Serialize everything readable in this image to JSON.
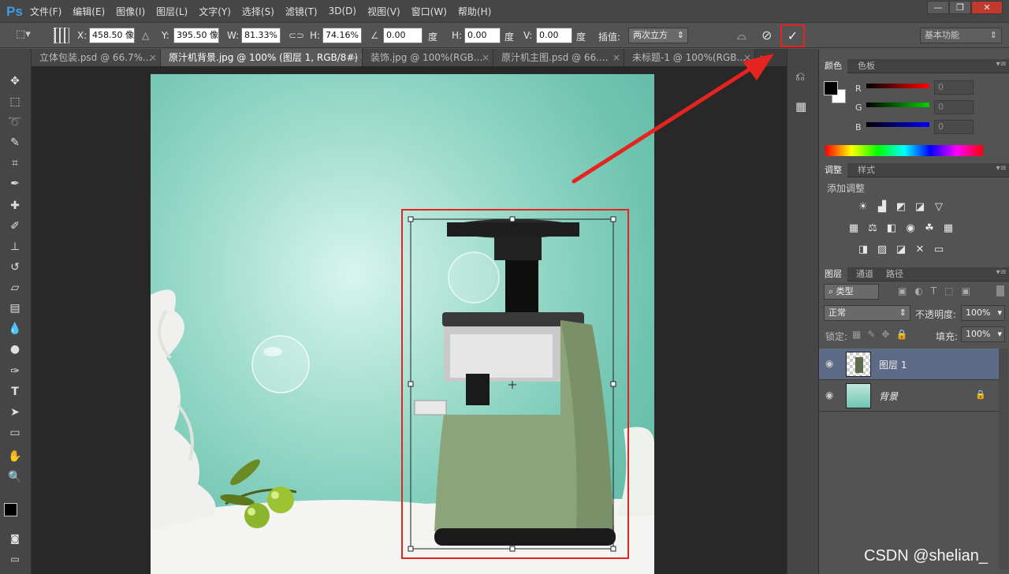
{
  "app": {
    "logo": "Ps"
  },
  "menu": [
    "文件(F)",
    "编辑(E)",
    "图像(I)",
    "图层(L)",
    "文字(Y)",
    "选择(S)",
    "滤镜(T)",
    "3D(D)",
    "视图(V)",
    "窗口(W)",
    "帮助(H)"
  ],
  "window_buttons": {
    "minimize": "—",
    "restore": "❐",
    "close": "✕"
  },
  "options": {
    "x_label": "X:",
    "x_value": "458.50 像",
    "y_label": "Y:",
    "y_value": "395.50 像",
    "w_label": "W:",
    "w_value": "81.33%",
    "h_label": "H:",
    "h_value": "74.16%",
    "angle_value": "0.00",
    "angle_unit": "度",
    "hskew_label": "H:",
    "hskew_value": "0.00",
    "hskew_unit": "度",
    "vskew_label": "V:",
    "vskew_value": "0.00",
    "vskew_unit": "度",
    "interp_label": "插值:",
    "interp_value": "两次立方",
    "workspace": "基本功能"
  },
  "tabs": [
    {
      "label": "立体包装.psd @ 66.7%..."
    },
    {
      "label": "原汁机背景.jpg @ 100% (图层 1, RGB/8#) *"
    },
    {
      "label": "装饰.jpg @ 100%(RGB..."
    },
    {
      "label": "原汁机主图.psd @ 66...."
    },
    {
      "label": "未标题-1 @ 100%(RGB..."
    }
  ],
  "color_panel": {
    "tabs": [
      "颜色",
      "色板"
    ],
    "r": "R",
    "g": "G",
    "b": "B",
    "r_val": "0",
    "g_val": "0",
    "b_val": "0"
  },
  "adjust_panel": {
    "tabs": [
      "调整",
      "样式"
    ],
    "title": "添加调整"
  },
  "layers_panel": {
    "tabs": [
      "图层",
      "通道",
      "路径"
    ],
    "filter": "类型",
    "blend": "正常",
    "opacity_label": "不透明度:",
    "opacity": "100%",
    "lock_label": "锁定:",
    "fill_label": "填充:",
    "fill": "100%",
    "layers": [
      {
        "name": "图层 1"
      },
      {
        "name": "背景"
      }
    ]
  },
  "watermark": "CSDN @shelian_",
  "colors": {
    "annotation_red": "#e52420",
    "accent_blue": "#3d9ee8",
    "panel_bg": "#535353"
  }
}
